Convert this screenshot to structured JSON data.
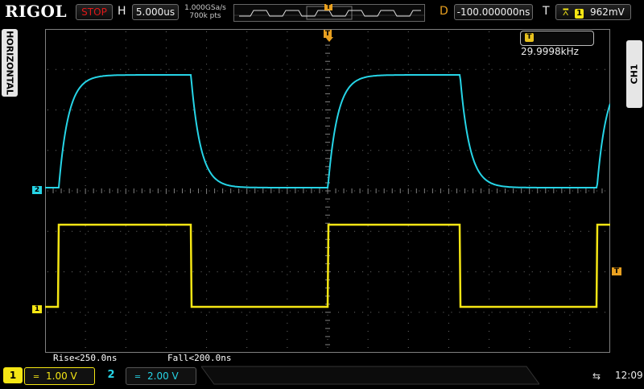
{
  "brand": "RIGOL",
  "run_state": "STOP",
  "horizontal": {
    "label": "H",
    "timebase": "5.000us",
    "sample_rate": "1.000GSa/s",
    "memory_depth": "700k pts"
  },
  "delay": {
    "label": "D",
    "value": "-100.000000ns"
  },
  "trigger": {
    "label": "T",
    "source_badge": "1",
    "level": "962mV",
    "slope_icon": "rising-edge-icon"
  },
  "side_tabs": {
    "left": "HORIZONTAL",
    "right": "CH1"
  },
  "frequency_readout": {
    "badge": "T",
    "value": "29.9998kHz"
  },
  "measurements": {
    "rise": "Rise<250.0ns",
    "fall": "Fall<200.0ns"
  },
  "channels": [
    {
      "number": "1",
      "scale": "1.00 V",
      "coupling_icon": "dc-coupling-icon",
      "color": "#f5e614"
    },
    {
      "number": "2",
      "scale": "2.00 V",
      "coupling_icon": "dc-coupling-icon",
      "color": "#26d4e6"
    }
  ],
  "markers": {
    "ch1_ground": "1",
    "ch2_ground": "2",
    "trigger_level": "T",
    "trigger_position": "T"
  },
  "status": {
    "clock": "12:09",
    "usb_icon": "usb-icon"
  },
  "colors": {
    "ch1": "#f5e614",
    "ch2": "#26d4e6",
    "stop": "#e01818",
    "trigger_marker": "#e8a020",
    "grid": "#808080"
  }
}
